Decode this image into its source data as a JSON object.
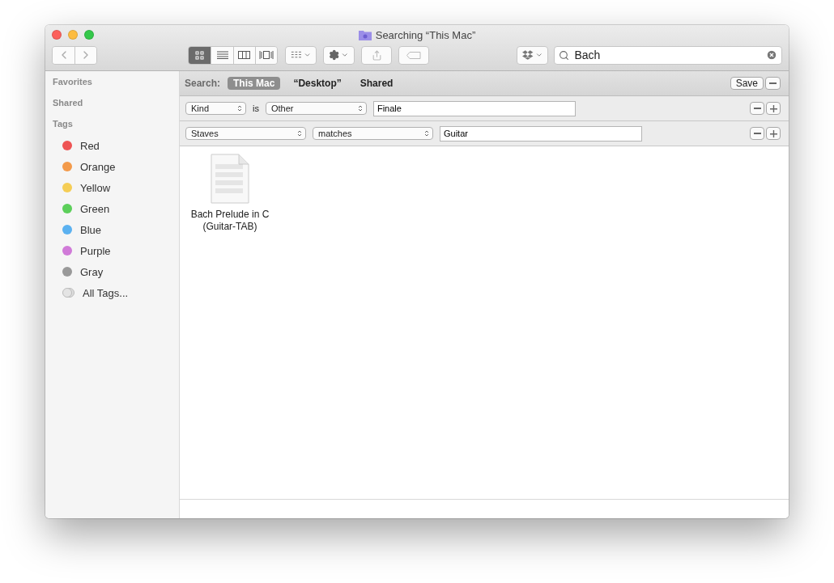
{
  "window": {
    "title": "Searching “This Mac”"
  },
  "toolbar": {
    "view_modes": [
      {
        "kind": "icons",
        "selected": true
      },
      {
        "kind": "list",
        "selected": false
      },
      {
        "kind": "columns",
        "selected": false
      },
      {
        "kind": "cover",
        "selected": false
      }
    ],
    "search_field": {
      "value": "Bach"
    }
  },
  "sidebar": {
    "sections": [
      {
        "title": "Favorites"
      },
      {
        "title": "Shared"
      },
      {
        "title": "Tags",
        "items": [
          {
            "name": "Red",
            "kind": "tag",
            "color": "#ee5454"
          },
          {
            "name": "Orange",
            "kind": "tag",
            "color": "#f39a4a"
          },
          {
            "name": "Yellow",
            "kind": "tag",
            "color": "#f5cd55"
          },
          {
            "name": "Green",
            "kind": "tag",
            "color": "#5ccf5a"
          },
          {
            "name": "Blue",
            "kind": "tag",
            "color": "#5bb1f0"
          },
          {
            "name": "Purple",
            "kind": "tag",
            "color": "#d07ad8"
          },
          {
            "name": "Gray",
            "kind": "tag",
            "color": "#999999"
          },
          {
            "name": "All Tags...",
            "kind": "all"
          }
        ]
      }
    ]
  },
  "search_bar": {
    "label": "Search:",
    "scopes": [
      {
        "label": "This Mac",
        "selected": true
      },
      {
        "label": "“Desktop”",
        "selected": false
      },
      {
        "label": "Shared",
        "selected": false
      }
    ],
    "save": "Save"
  },
  "criteria": [
    {
      "parts": [
        {
          "kind": "popup",
          "label": "Kind"
        },
        {
          "kind": "text",
          "label": "is"
        },
        {
          "kind": "popup",
          "label": "Other"
        },
        {
          "kind": "field",
          "value": "Finale"
        }
      ]
    },
    {
      "parts": [
        {
          "kind": "popup",
          "label": "Staves"
        },
        {
          "kind": "popup",
          "label": "matches"
        },
        {
          "kind": "field",
          "value": "Guitar"
        }
      ]
    }
  ],
  "files": [
    {
      "name": "Bach Prelude in C (Guitar-TAB)"
    }
  ]
}
